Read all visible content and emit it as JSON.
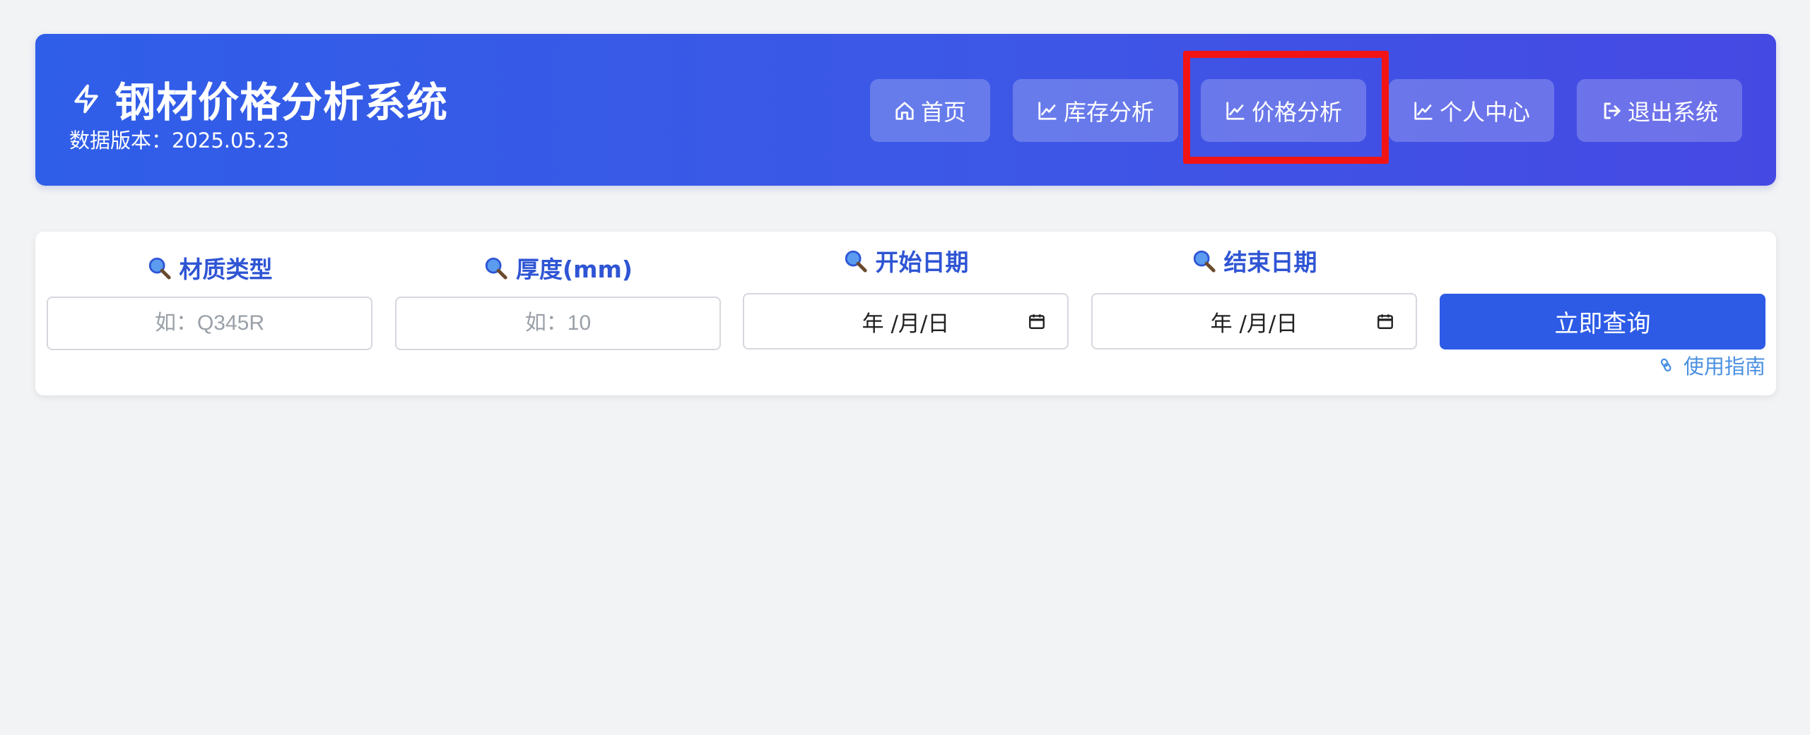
{
  "header": {
    "title": "钢材价格分析系统",
    "version": "数据版本：2025.05.23",
    "nav": [
      {
        "label": "首页",
        "icon": "home-icon"
      },
      {
        "label": "库存分析",
        "icon": "chart-line-icon"
      },
      {
        "label": "价格分析",
        "icon": "chart-line-icon"
      },
      {
        "label": "个人中心",
        "icon": "chart-line-icon"
      },
      {
        "label": "退出系统",
        "icon": "sign-out-icon"
      }
    ]
  },
  "search": {
    "material": {
      "label": "材质类型",
      "placeholder": "如：Q345R"
    },
    "thickness": {
      "label": "厚度(mm)",
      "placeholder": "如：10"
    },
    "start_date": {
      "label": "开始日期",
      "value": "年 /月/日"
    },
    "end_date": {
      "label": "结束日期",
      "value": "年 /月/日"
    },
    "query_button": "立即查询",
    "guide_link": "使用指南"
  },
  "colors": {
    "header_gradient_start": "#2f5ee8",
    "header_gradient_end": "#4549e3",
    "primary": "#2d5be6",
    "highlight": "#f21414",
    "link": "#4a90e2"
  }
}
